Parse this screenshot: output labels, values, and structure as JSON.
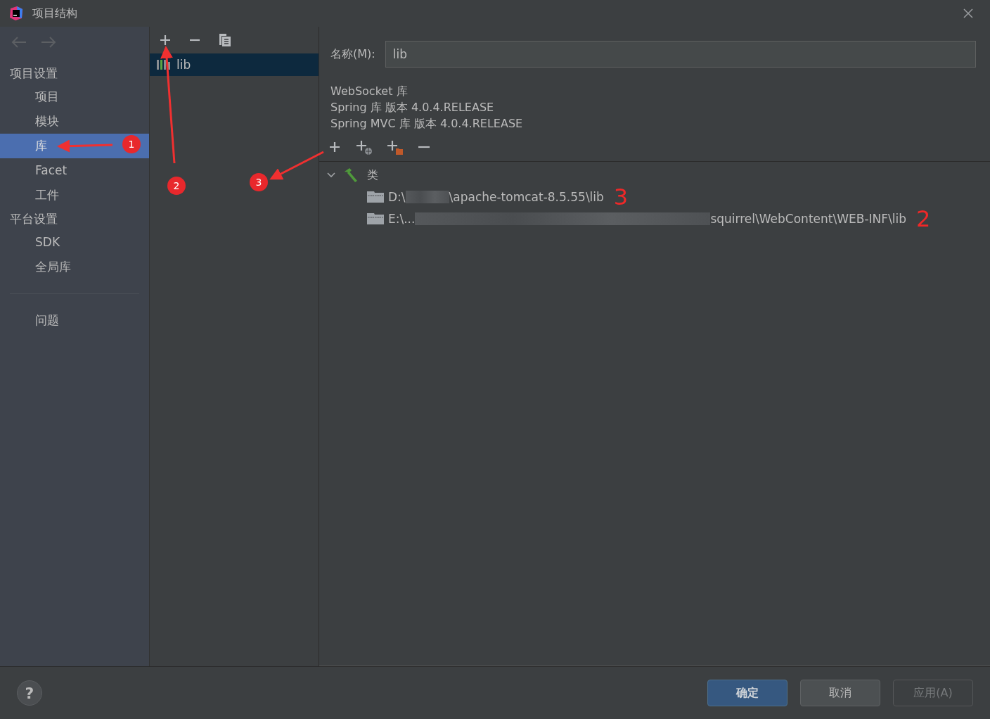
{
  "window": {
    "title": "项目结构"
  },
  "sidebar": {
    "items": [
      {
        "label": "项目设置",
        "kind": "header"
      },
      {
        "label": "项目",
        "kind": "item",
        "selected": false
      },
      {
        "label": "模块",
        "kind": "item",
        "selected": false
      },
      {
        "label": "库",
        "kind": "item",
        "selected": true
      },
      {
        "label": "Facet",
        "kind": "item",
        "selected": false
      },
      {
        "label": "工件",
        "kind": "item",
        "selected": false
      },
      {
        "label": "平台设置",
        "kind": "header"
      },
      {
        "label": "SDK",
        "kind": "item",
        "selected": false
      },
      {
        "label": "全局库",
        "kind": "item",
        "selected": false
      },
      {
        "kind": "divider"
      },
      {
        "label": "问题",
        "kind": "item",
        "selected": false
      }
    ]
  },
  "libraries": [
    {
      "label": "lib",
      "selected": true
    }
  ],
  "name_field": {
    "label": "名称(M):",
    "value": "lib"
  },
  "descriptions": [
    "WebSocket 库",
    "Spring 库  版本 4.0.4.RELEASE",
    "Spring MVC 库  版本 4.0.4.RELEASE"
  ],
  "tree": {
    "label": "类",
    "expanded": true,
    "children": [
      {
        "prefix": "D:\\",
        "suffix": "\\apache-tomcat-8.5.55\\lib",
        "note": "3"
      },
      {
        "prefix": "E:\\...",
        "suffix": "squirrel\\WebContent\\WEB-INF\\lib",
        "note": "2"
      }
    ]
  },
  "annotations": [
    {
      "label": "1"
    },
    {
      "label": "2"
    },
    {
      "label": "3"
    }
  ],
  "help": "?",
  "buttons": [
    {
      "label": "确定",
      "kind": "primary"
    },
    {
      "label": "取消",
      "kind": "normal"
    },
    {
      "label": "应用(A)",
      "kind": "disabled"
    }
  ]
}
